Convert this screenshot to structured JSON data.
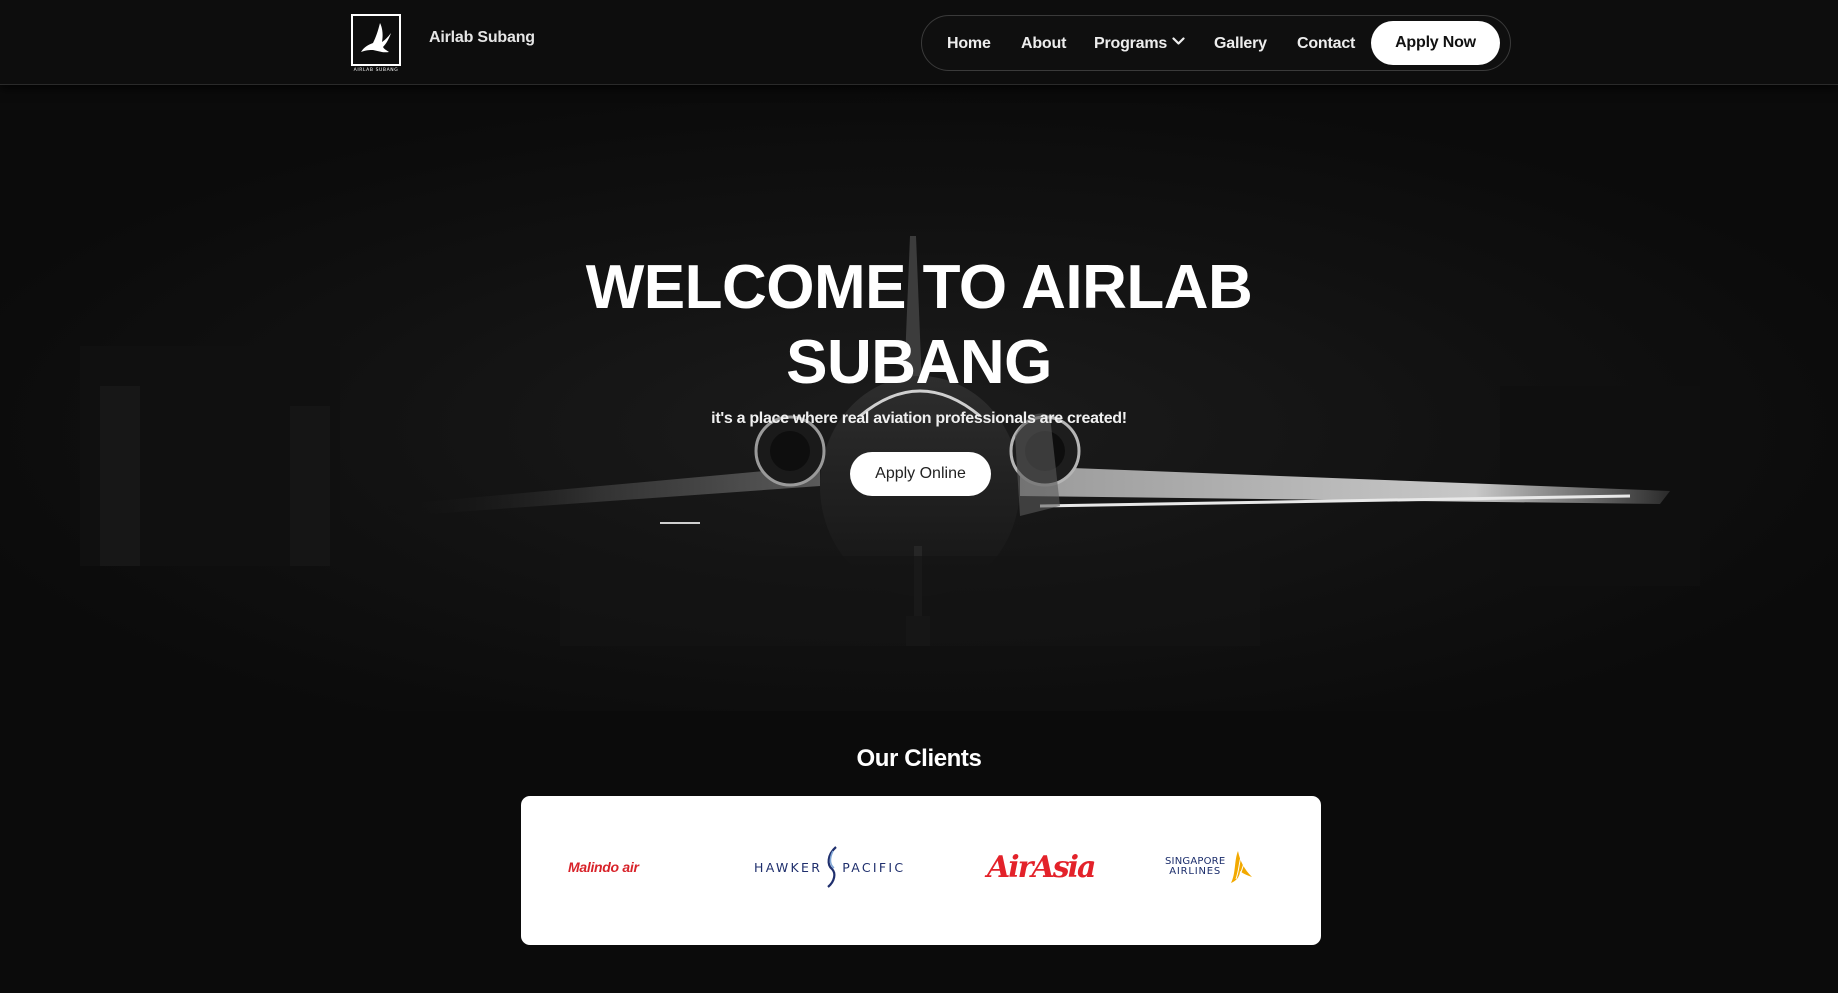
{
  "colors": {
    "background": "#0b0b0b",
    "button_bg": "#ffffff",
    "button_text": "#111111",
    "malindo_red": "#d8232a",
    "hawker_navy": "#1f2f6d",
    "airasia_red": "#e3222a",
    "singapore_navy": "#1b2d6b",
    "singapore_gold": "#f2a900"
  },
  "header": {
    "logo_text": "AIRLAB SUBANG",
    "brand_name": "Airlab Subang",
    "nav": {
      "home": "Home",
      "about": "About",
      "programs": "Programs",
      "gallery": "Gallery",
      "contact": "Contact"
    },
    "apply_now": "Apply Now"
  },
  "hero": {
    "title": "WELCOME TO AIRLAB SUBANG",
    "subtitle": "it's a place where real aviation professionals are created!",
    "cta": "Apply Online"
  },
  "clients": {
    "title": "Our Clients",
    "logos": {
      "malindo": "Malindo air",
      "hawker_left": "HAWKER",
      "hawker_right": "PACIFIC",
      "airasia": "AirAsia",
      "singapore_line1": "SINGAPORE",
      "singapore_line2": "AIRLINES"
    }
  }
}
